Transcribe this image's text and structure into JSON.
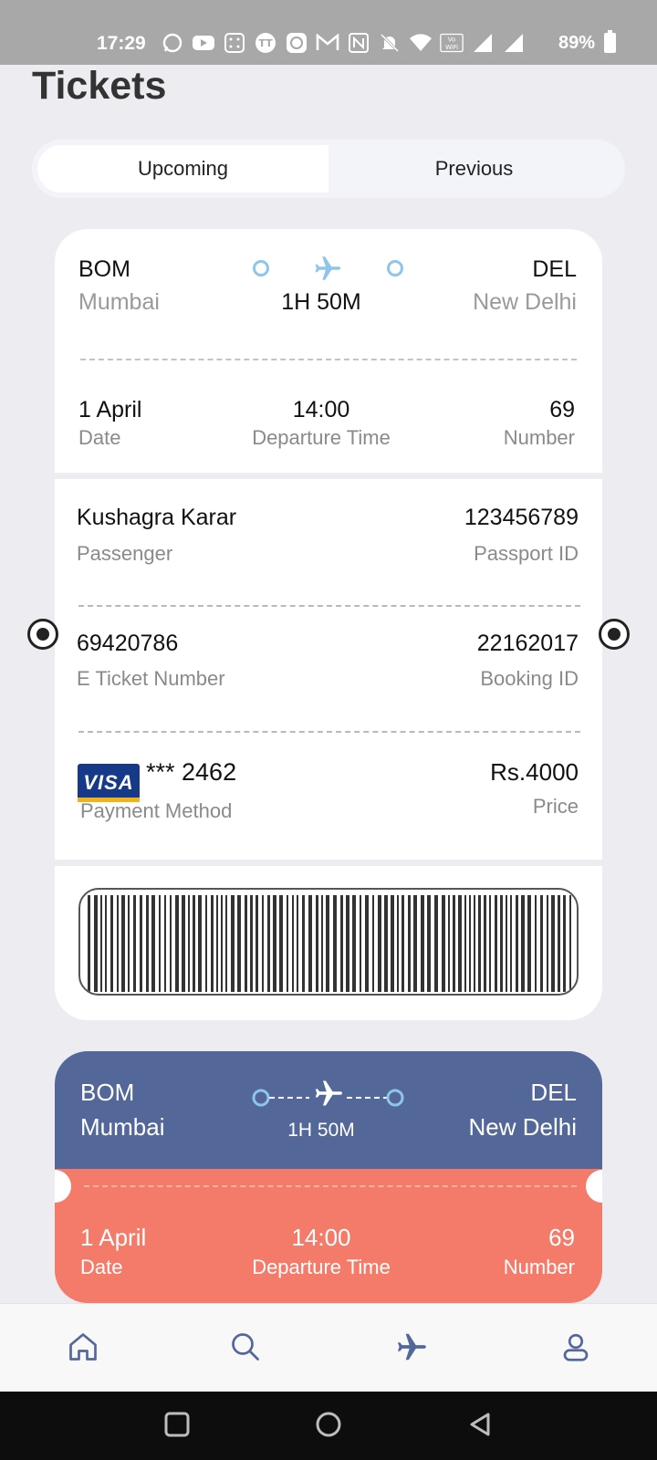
{
  "status_bar": {
    "time": "17:29",
    "battery_percent": "89%",
    "icons": [
      "whatsapp-icon",
      "youtube-icon",
      "app-grid-icon",
      "tt-icon",
      "cb-icon",
      "gmail-icon",
      "nfc-icon",
      "mute-icon",
      "wifi-icon",
      "vowifi-icon",
      "signal-icon",
      "signal-icon",
      "battery-icon"
    ]
  },
  "page": {
    "title": "Tickets"
  },
  "tabs": [
    {
      "label": "Upcoming",
      "active": true
    },
    {
      "label": "Previous",
      "active": false
    }
  ],
  "ticket": {
    "from_code": "BOM",
    "from_city": "Mumbai",
    "to_code": "DEL",
    "to_city": "New Delhi",
    "duration": "1H 50M",
    "date_value": "1 April",
    "date_label": "Date",
    "time_value": "14:00",
    "time_label": "Departure Time",
    "number_value": "69",
    "number_label": "Number",
    "passenger_value": "Kushagra Karar",
    "passenger_label": "Passenger",
    "passport_value": "123456789",
    "passport_label": "Passport ID",
    "eticket_value": "69420786",
    "eticket_label": "E Ticket Number",
    "booking_value": "22162017",
    "booking_label": "Booking ID",
    "card_brand": "VISA",
    "card_number": "*** 2462",
    "payment_label": "Payment Method",
    "price_value": "Rs.4000",
    "price_label": "Price"
  },
  "ticket2": {
    "from_code": "BOM",
    "from_city": "Mumbai",
    "to_code": "DEL",
    "to_city": "New Delhi",
    "duration": "1H 50M",
    "date_value": "1 April",
    "date_label": "Date",
    "time_value": "14:00",
    "time_label": "Departure Time",
    "number_value": "69",
    "number_label": "Number"
  },
  "bottom_nav": [
    {
      "icon": "home-icon",
      "active": false
    },
    {
      "icon": "search-icon",
      "active": false
    },
    {
      "icon": "airplane-icon",
      "active": true
    },
    {
      "icon": "profile-icon",
      "active": false
    }
  ],
  "colors": {
    "accent_blue": "#536799",
    "accent_coral": "#f47b69",
    "route_blue": "#8ec5ea"
  }
}
